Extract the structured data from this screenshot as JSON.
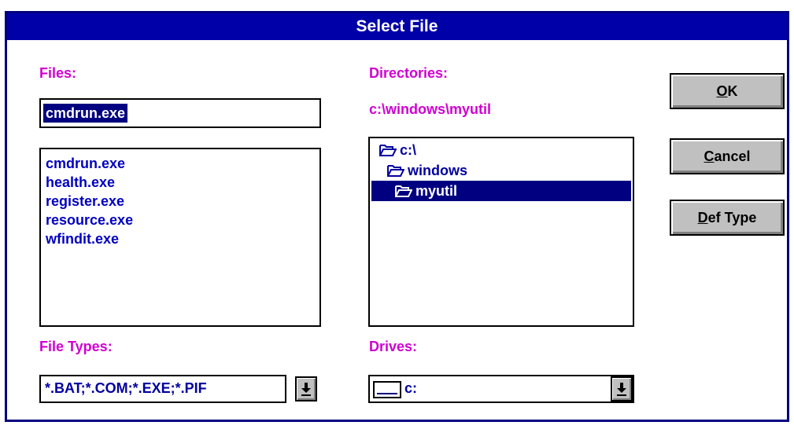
{
  "dialog": {
    "title": "Select File"
  },
  "files": {
    "label": "Files:",
    "filename_value": "cmdrun.exe",
    "items": [
      "cmdrun.exe",
      "health.exe",
      "register.exe",
      "resource.exe",
      "wfindit.exe"
    ]
  },
  "directories": {
    "label": "Directories:",
    "current_path": "c:\\windows\\myutil",
    "items": [
      {
        "label": "c:\\",
        "icon": "open-folder-icon"
      },
      {
        "label": "windows",
        "icon": "open-folder-icon"
      },
      {
        "label": "myutil",
        "icon": "open-folder-icon",
        "selected": true
      }
    ]
  },
  "file_types": {
    "label": "File Types:",
    "selected": "*.BAT;*.COM;*.EXE;*.PIF"
  },
  "drives": {
    "label": "Drives:",
    "selected": "c:",
    "icon": "drive-icon"
  },
  "buttons": {
    "ok_ul": "O",
    "ok_rest": "K",
    "cancel_ul": "C",
    "cancel_rest": "ancel",
    "deftype_ul": "D",
    "deftype_rest": "ef Type"
  },
  "colors": {
    "title_bar": "#0000a8",
    "label": "#d000d0",
    "list_text": "#0000c0",
    "selection": "#000080"
  }
}
